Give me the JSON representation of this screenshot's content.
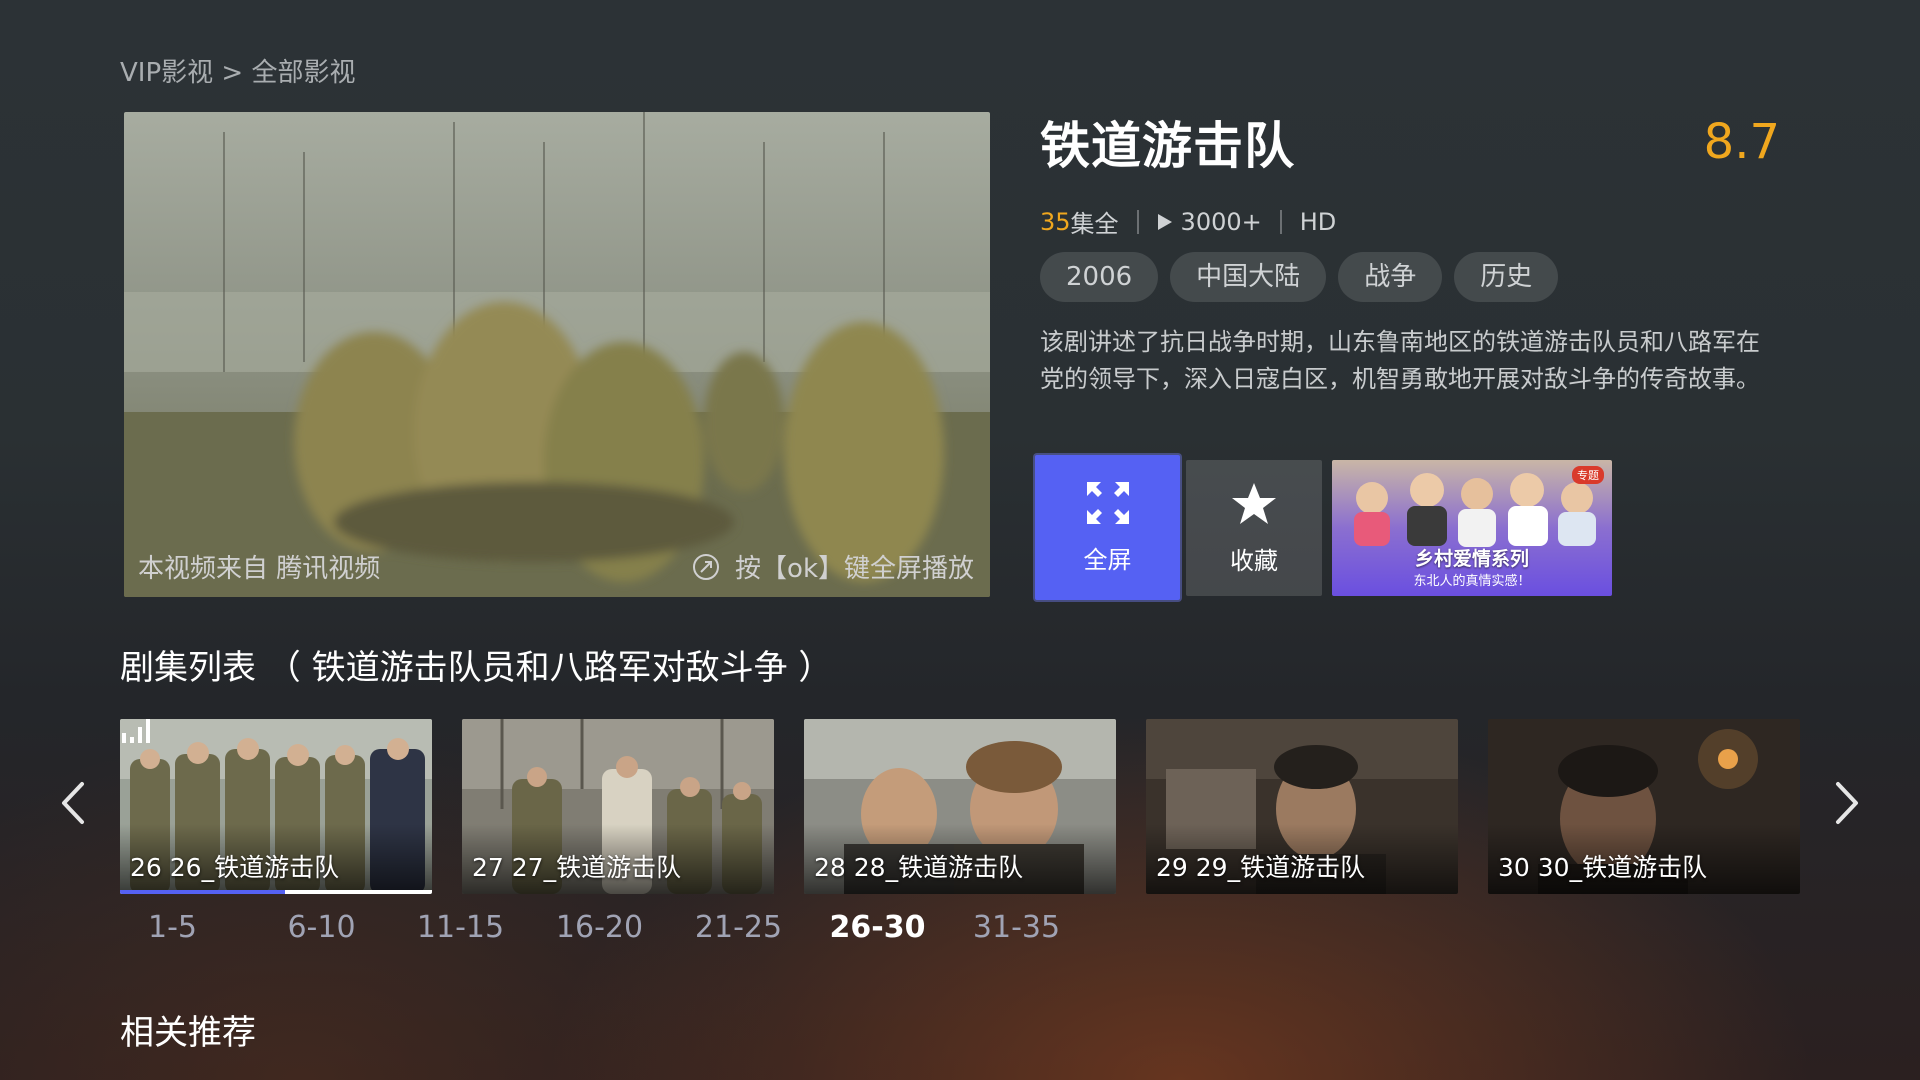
{
  "breadcrumb": "VIP影视 > 全部影视",
  "player": {
    "source_text": "本视频来自 腾讯视频",
    "hint_text": "按【ok】键全屏播放"
  },
  "show": {
    "title": "铁道游击队",
    "score": "8.7",
    "episodes_count": "35",
    "episodes_suffix": "集全",
    "plays": "3000+",
    "quality": "HD",
    "tags": [
      "2006",
      "中国大陆",
      "战争",
      "历史"
    ],
    "description": "该剧讲述了抗日战争时期，山东鲁南地区的铁道游击队员和八路军在党的领导下，深入日寇白区，机智勇敢地开展对敌斗争的传奇故事。"
  },
  "actions": {
    "fullscreen_label": "全屏",
    "favorite_label": "收藏"
  },
  "promo": {
    "badge": "专题",
    "title": "乡村爱情系列",
    "subtitle": "东北人的真情实感！"
  },
  "episode_list": {
    "title": "剧集列表 （ 铁道游击队员和八路军对敌斗争 ）",
    "items": [
      {
        "label": "26 26_铁道游击队",
        "progress": 0.53
      },
      {
        "label": "27 27_铁道游击队"
      },
      {
        "label": "28 28_铁道游击队"
      },
      {
        "label": "29 29_铁道游击队"
      },
      {
        "label": "30 30_铁道游击队"
      }
    ],
    "ranges": [
      "1-5",
      "6-10",
      "11-15",
      "16-20",
      "21-25",
      "26-30",
      "31-35"
    ],
    "active_range": "26-30"
  },
  "related": {
    "title": "相关推荐"
  },
  "colors": {
    "accent": "#5561f3",
    "score": "#f0a71e"
  }
}
